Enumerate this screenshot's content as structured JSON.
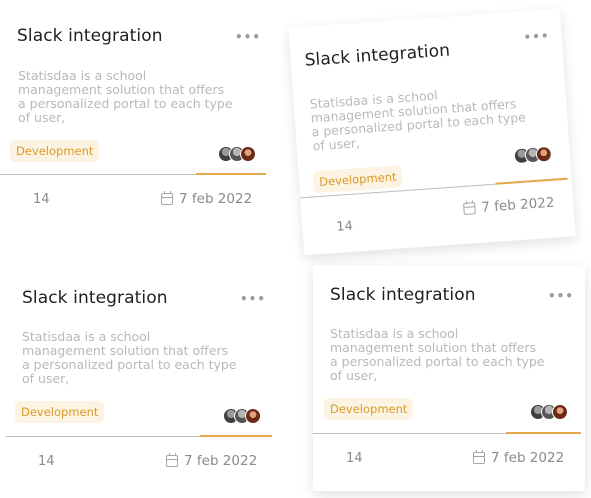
{
  "cards": [
    {
      "title": "Slack integration",
      "more": "•••",
      "description": "Statisdaa is a  school\nmanagement solution that offers\na personalized portal to each type\nof user,",
      "tag": "Development",
      "count": "14",
      "date": "7 feb 2022"
    },
    {
      "title": "Slack integration",
      "more": "•••",
      "description": "Statisdaa is a  school\nmanagement solution that offers\na personalized portal to each type\nof user,",
      "tag": "Development",
      "count": "14",
      "date": "7 feb 2022"
    },
    {
      "title": "Slack integration",
      "more": "•••",
      "description": "Statisdaa is a  school\nmanagement solution that offers\na personalized portal to each type\nof user,",
      "tag": "Development",
      "count": "14",
      "date": "7 feb 2022"
    },
    {
      "title": "Slack integration",
      "more": "•••",
      "description": "Statisdaa is a  school\nmanagement solution that offers\na personalized portal to each type\nof user,",
      "tag": "Development",
      "count": "14",
      "date": "7 feb 2022"
    }
  ],
  "colors": {
    "tag_background": "#fdf3e2",
    "tag_text": "#d99a28",
    "accent_line": "#e3a94b"
  }
}
